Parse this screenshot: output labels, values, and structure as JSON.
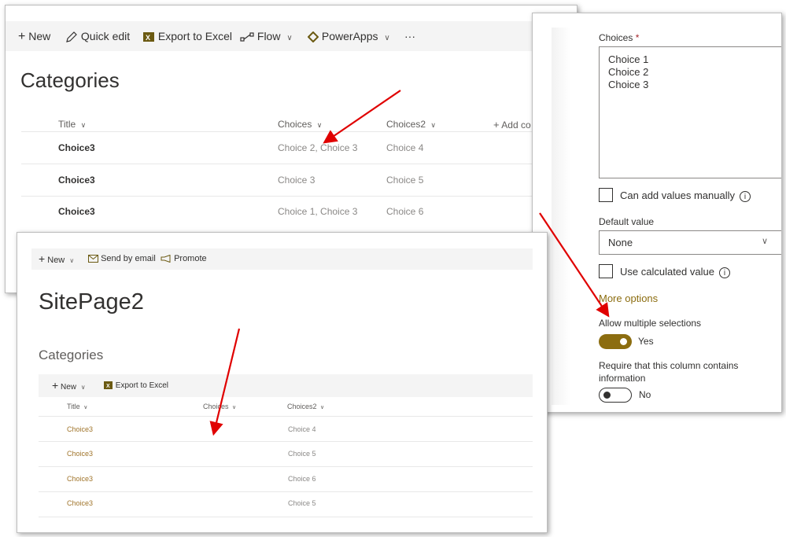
{
  "list_view": {
    "toolbar": {
      "new": "New",
      "quick_edit": "Quick edit",
      "export": "Export to Excel",
      "flow": "Flow",
      "powerapps": "PowerApps",
      "more": "···"
    },
    "title": "Categories",
    "columns": {
      "title": "Title",
      "choices": "Choices",
      "choices2": "Choices2",
      "add_column": "Add co"
    },
    "rows": [
      {
        "title": "Choice3",
        "choices": "Choice 2, Choice 3",
        "choices2": "Choice 4"
      },
      {
        "title": "Choice3",
        "choices": "Choice 3",
        "choices2": "Choice 5"
      },
      {
        "title": "Choice3",
        "choices": "Choice 1, Choice 3",
        "choices2": "Choice 6"
      }
    ]
  },
  "column_settings": {
    "choices_label": "Choices",
    "required_mark": "*",
    "choices_lines": [
      "Choice 1",
      "Choice 2",
      "Choice 3"
    ],
    "can_add_values": "Can add values manually",
    "default_value_label": "Default value",
    "default_value": "None",
    "use_calculated": "Use calculated value",
    "more_options": "More options",
    "allow_multiple_label": "Allow multiple selections",
    "allow_multiple_value": "Yes",
    "require_label_line1": "Require that this column contains",
    "require_label_line2": "information",
    "require_value": "No",
    "toggle_on_color": "#8c6d10"
  },
  "site_page": {
    "toolbar": {
      "new": "New",
      "send_email": "Send by email",
      "promote": "Promote"
    },
    "page_title": "SitePage2",
    "webpart_title": "Categories",
    "webpart_toolbar": {
      "new": "New",
      "export": "Export to Excel"
    },
    "columns": {
      "title": "Title",
      "choices": "Choices",
      "choices2": "Choices2"
    },
    "rows": [
      {
        "title": "Choice3",
        "choices2": "Choice 4"
      },
      {
        "title": "Choice3",
        "choices2": "Choice 5"
      },
      {
        "title": "Choice3",
        "choices2": "Choice 6"
      },
      {
        "title": "Choice3",
        "choices2": "Choice 5"
      }
    ]
  }
}
